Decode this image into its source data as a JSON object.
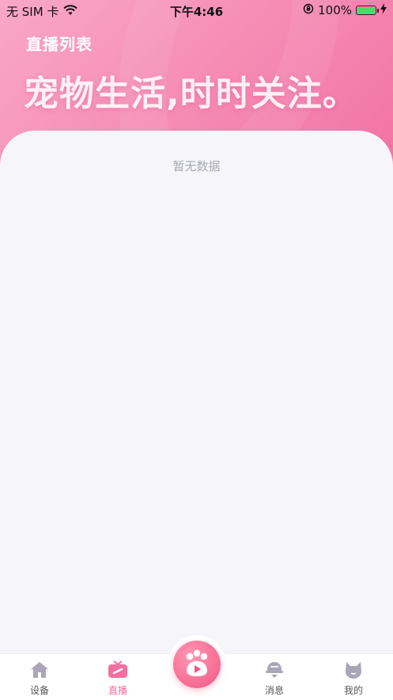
{
  "status_bar": {
    "carrier": "无 SIM 卡",
    "time": "下午4:46",
    "battery_percent": "100%",
    "battery_level": 1.0
  },
  "header": {
    "title": "直播列表",
    "slogan": "宠物生活,时时关注。"
  },
  "content": {
    "empty_text": "暂无数据"
  },
  "tabbar": {
    "items": [
      {
        "label": "设备",
        "icon": "house-icon"
      },
      {
        "label": "直播",
        "icon": "tv-icon"
      },
      {
        "label": "",
        "icon": "paw-play-icon"
      },
      {
        "label": "消息",
        "icon": "bell-icon"
      },
      {
        "label": "我的",
        "icon": "cat-icon"
      }
    ],
    "active_index": 1
  },
  "colors": {
    "accent": "#f26f9f",
    "header_start": "#f9a8c6",
    "header_end": "#f272a6",
    "inactive_icon": "#aaa6b8"
  }
}
